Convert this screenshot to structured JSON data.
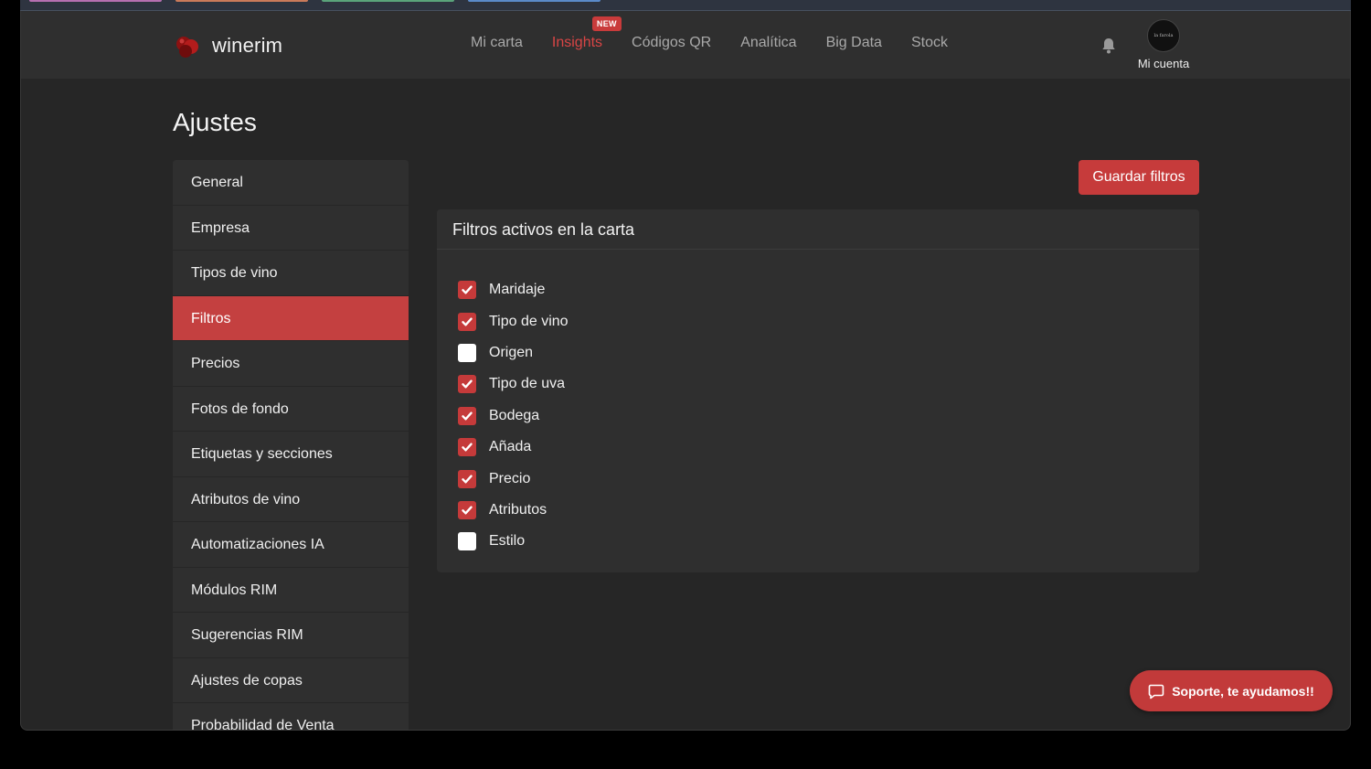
{
  "colors": {
    "accent": "#c44040",
    "background": "#262626",
    "panel": "#2f2f2f"
  },
  "brand": {
    "name": "winerim",
    "logo_icon": "wine-grape-icon"
  },
  "nav": {
    "items": [
      {
        "label": "Mi carta"
      },
      {
        "label": "Insights",
        "badge": "NEW"
      },
      {
        "label": "Códigos QR"
      },
      {
        "label": "Analítica"
      },
      {
        "label": "Big Data"
      },
      {
        "label": "Stock"
      }
    ],
    "active_index": 1
  },
  "account": {
    "label": "Mi cuenta",
    "avatar_text": "la farola",
    "bell_icon": "bell-icon"
  },
  "page": {
    "title": "Ajustes"
  },
  "sidebar": {
    "items": [
      {
        "label": "General"
      },
      {
        "label": "Empresa"
      },
      {
        "label": "Tipos de vino"
      },
      {
        "label": "Filtros"
      },
      {
        "label": "Precios"
      },
      {
        "label": "Fotos de fondo"
      },
      {
        "label": "Etiquetas y secciones"
      },
      {
        "label": "Atributos de vino"
      },
      {
        "label": "Automatizaciones IA"
      },
      {
        "label": "Módulos RIM"
      },
      {
        "label": "Sugerencias RIM"
      },
      {
        "label": "Ajustes de copas"
      },
      {
        "label": "Probabilidad de Venta"
      }
    ],
    "active_index": 3
  },
  "actions": {
    "save_label": "Guardar filtros"
  },
  "card": {
    "title": "Filtros activos en la carta",
    "filters": [
      {
        "label": "Maridaje",
        "checked": true
      },
      {
        "label": "Tipo de vino",
        "checked": true
      },
      {
        "label": "Origen",
        "checked": false
      },
      {
        "label": "Tipo de uva",
        "checked": true
      },
      {
        "label": "Bodega",
        "checked": true
      },
      {
        "label": "Añada",
        "checked": true
      },
      {
        "label": "Precio",
        "checked": true
      },
      {
        "label": "Atributos",
        "checked": true
      },
      {
        "label": "Estilo",
        "checked": false
      }
    ]
  },
  "support": {
    "label": "Soporte, te ayudamos!!",
    "icon": "chat-bubble-icon"
  }
}
